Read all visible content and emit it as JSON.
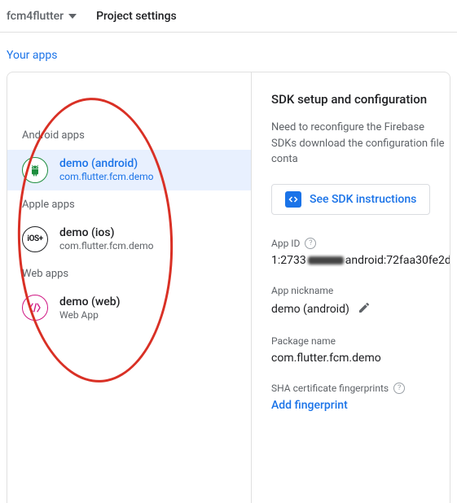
{
  "header": {
    "project_name": "fcm4flutter",
    "tab_label": "Project settings"
  },
  "section_title": "Your apps",
  "sidebar": {
    "groups": [
      {
        "label": "Android apps",
        "apps": [
          {
            "name": "demo (android)",
            "sub": "com.flutter.fcm.demo",
            "platform": "android",
            "selected": true
          }
        ]
      },
      {
        "label": "Apple apps",
        "apps": [
          {
            "name": "demo (ios)",
            "sub": "com.flutter.fcm.demo",
            "platform": "ios",
            "selected": false
          }
        ]
      },
      {
        "label": "Web apps",
        "apps": [
          {
            "name": "demo (web)",
            "sub": "Web App",
            "platform": "web",
            "selected": false
          }
        ]
      }
    ]
  },
  "detail": {
    "title": "SDK setup and configuration",
    "desc": "Need to reconfigure the Firebase SDKs download the configuration file conta",
    "sdk_button": "See SDK instructions",
    "app_id_label": "App ID",
    "app_id_prefix": "1:2733",
    "app_id_suffix": "android:72faa30fe2d",
    "nickname_label": "App nickname",
    "nickname_value": "demo (android)",
    "package_label": "Package name",
    "package_value": "com.flutter.fcm.demo",
    "sha_label": "SHA certificate fingerprints",
    "add_fingerprint": "Add fingerprint"
  },
  "icons": {
    "ios_text": "iOS+"
  }
}
